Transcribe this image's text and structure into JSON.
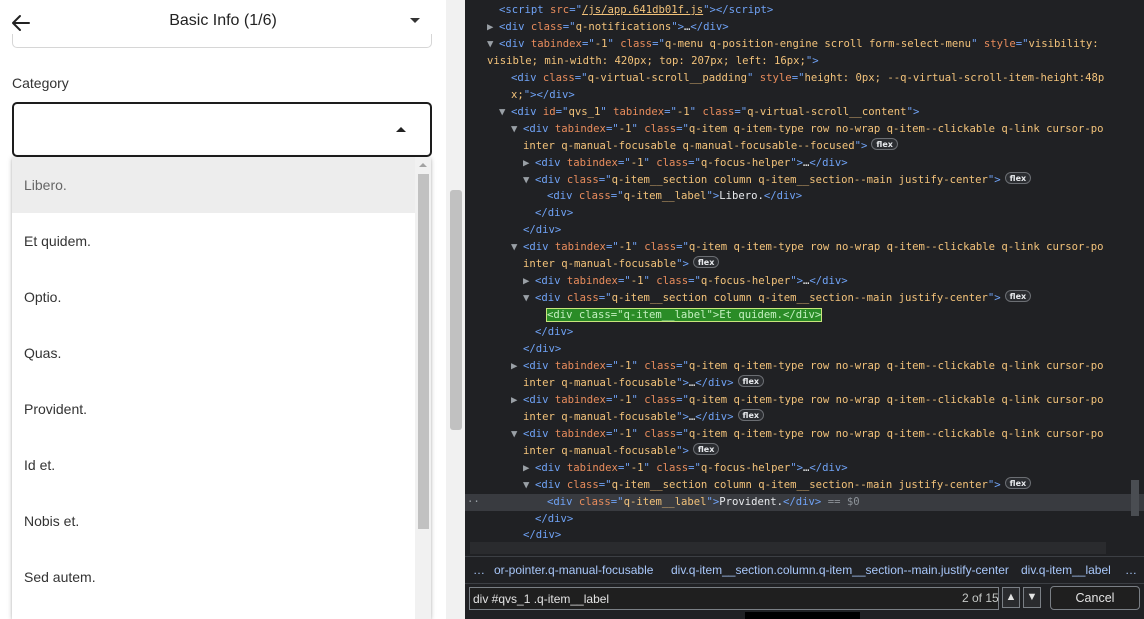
{
  "app": {
    "title": "Basic Info (1/6)",
    "back_icon": "arrow-left-icon",
    "category_label": "Category",
    "category_value": "",
    "options": [
      "Libero.",
      "Et quidem.",
      "Optio.",
      "Quas.",
      "Provident.",
      "Id et.",
      "Nobis et.",
      "Sed autem."
    ],
    "focused_option": "Libero."
  },
  "devtools": {
    "lines": [
      {
        "indent": 0,
        "tri": "",
        "html": "<span class='tg'>&lt;script</span> <span class='an'>src</span><span class='tg'>=\"</span><span class='av ul'>/js/app.641db01f.js</span><span class='tg'>\"&gt;&lt;/script&gt;</span>"
      },
      {
        "indent": 0,
        "tri": "▶",
        "html": "<span class='tg'>&lt;div</span> <span class='an'>class</span><span class='tg'>=\"</span><span class='av'>q-notifications</span><span class='tg'>\"&gt;</span><span class='tx'>…</span><span class='tg'>&lt;/div&gt;</span>"
      },
      {
        "indent": 0,
        "tri": "▼",
        "html": "<span class='tg'>&lt;div</span> <span class='an'>tabindex</span><span class='tg'>=\"</span><span class='av'>-1</span><span class='tg'>\"</span> <span class='an'>class</span><span class='tg'>=\"</span><span class='av'>q-menu q-position-engine scroll form-select-menu</span><span class='tg'>\"</span> <span class='an'>style</span><span class='tg'>=\"</span><span class='av'>visibility:</span>"
      },
      {
        "indent": -2,
        "tri": "",
        "html": "<span class='av'>visible; min-width: 420px; top: 207px; left: 16px;</span><span class='tg'>\"&gt;</span>"
      },
      {
        "indent": 1,
        "tri": "",
        "html": "<span class='tg'>&lt;div</span> <span class='an'>class</span><span class='tg'>=\"</span><span class='av'>q-virtual-scroll__padding</span><span class='tg'>\"</span> <span class='an'>style</span><span class='tg'>=\"</span><span class='av'>height: 0px; --q-virtual-scroll-item-height:48p</span>"
      },
      {
        "indent": 1,
        "tri": "",
        "html": "<span class='av'>x;</span><span class='tg'>\"&gt;&lt;/div&gt;</span>"
      },
      {
        "indent": 1,
        "tri": "▼",
        "html": "<span class='tg'>&lt;div</span> <span class='an'>id</span><span class='tg'>=\"</span><span class='av'>qvs_1</span><span class='tg'>\"</span> <span class='an'>tabindex</span><span class='tg'>=\"</span><span class='av'>-1</span><span class='tg'>\"</span> <span class='an'>class</span><span class='tg'>=\"</span><span class='av'>q-virtual-scroll__content</span><span class='tg'>\"&gt;</span>"
      },
      {
        "indent": 2,
        "tri": "▼",
        "html": "<span class='tg'>&lt;div</span> <span class='an'>tabindex</span><span class='tg'>=\"</span><span class='av'>-1</span><span class='tg'>\"</span> <span class='an'>class</span><span class='tg'>=\"</span><span class='av'>q-item q-item-type row no-wrap q-item--clickable q-link cursor-po</span>"
      },
      {
        "indent": 2,
        "tri": "",
        "html": "<span class='av'>inter q-manual-focusable q-manual-focusable--focused</span><span class='tg'>\"&gt;</span><span class='flex-badge'>flex</span>"
      },
      {
        "indent": 3,
        "tri": "▶",
        "html": "<span class='tg'>&lt;div</span> <span class='an'>tabindex</span><span class='tg'>=\"</span><span class='av'>-1</span><span class='tg'>\"</span> <span class='an'>class</span><span class='tg'>=\"</span><span class='av'>q-focus-helper</span><span class='tg'>\"&gt;</span><span class='tx'>…</span><span class='tg'>&lt;/div&gt;</span>"
      },
      {
        "indent": 3,
        "tri": "▼",
        "html": "<span class='tg'>&lt;div</span> <span class='an'>class</span><span class='tg'>=\"</span><span class='av'>q-item__section column q-item__section--main justify-center</span><span class='tg'>\"&gt;</span><span class='flex-badge'>flex</span>"
      },
      {
        "indent": 4,
        "tri": "",
        "html": "<span class='tg'>&lt;div</span> <span class='an'>class</span><span class='tg'>=\"</span><span class='av'>q-item__label</span><span class='tg'>\"&gt;</span><span class='tx'>Libero.</span><span class='tg'>&lt;/div&gt;</span>"
      },
      {
        "indent": 3,
        "tri": "",
        "html": "<span class='tg'>&lt;/div&gt;</span>"
      },
      {
        "indent": 2,
        "tri": "",
        "html": "<span class='tg'>&lt;/div&gt;</span>"
      },
      {
        "indent": 2,
        "tri": "▼",
        "html": "<span class='tg'>&lt;div</span> <span class='an'>tabindex</span><span class='tg'>=\"</span><span class='av'>-1</span><span class='tg'>\"</span> <span class='an'>class</span><span class='tg'>=\"</span><span class='av'>q-item q-item-type row no-wrap q-item--clickable q-link cursor-po</span>"
      },
      {
        "indent": 2,
        "tri": "",
        "html": "<span class='av'>inter q-manual-focusable</span><span class='tg'>\"&gt;</span><span class='flex-badge'>flex</span>"
      },
      {
        "indent": 3,
        "tri": "▶",
        "html": "<span class='tg'>&lt;div</span> <span class='an'>tabindex</span><span class='tg'>=\"</span><span class='av'>-1</span><span class='tg'>\"</span> <span class='an'>class</span><span class='tg'>=\"</span><span class='av'>q-focus-helper</span><span class='tg'>\"&gt;</span><span class='tx'>…</span><span class='tg'>&lt;/div&gt;</span>"
      },
      {
        "indent": 3,
        "tri": "▼",
        "html": "<span class='tg'>&lt;div</span> <span class='an'>class</span><span class='tg'>=\"</span><span class='av'>q-item__section column q-item__section--main justify-center</span><span class='tg'>\"&gt;</span><span class='flex-badge'>flex</span>"
      },
      {
        "indent": 4,
        "tri": "",
        "html": "<span class='hl'>&lt;div class=\"q-item__label\"&gt;Et quidem.&lt;/div&gt;</span>"
      },
      {
        "indent": 3,
        "tri": "",
        "html": "<span class='tg'>&lt;/div&gt;</span>"
      },
      {
        "indent": 2,
        "tri": "",
        "html": "<span class='tg'>&lt;/div&gt;</span>"
      },
      {
        "indent": 2,
        "tri": "▶",
        "html": "<span class='tg'>&lt;div</span> <span class='an'>tabindex</span><span class='tg'>=\"</span><span class='av'>-1</span><span class='tg'>\"</span> <span class='an'>class</span><span class='tg'>=\"</span><span class='av'>q-item q-item-type row no-wrap q-item--clickable q-link cursor-po</span>"
      },
      {
        "indent": 2,
        "tri": "",
        "html": "<span class='av'>inter q-manual-focusable</span><span class='tg'>\"&gt;</span><span class='tx'>…</span><span class='tg'>&lt;/div&gt;</span><span class='flex-badge'>flex</span>"
      },
      {
        "indent": 2,
        "tri": "▶",
        "html": "<span class='tg'>&lt;div</span> <span class='an'>tabindex</span><span class='tg'>=\"</span><span class='av'>-1</span><span class='tg'>\"</span> <span class='an'>class</span><span class='tg'>=\"</span><span class='av'>q-item q-item-type row no-wrap q-item--clickable q-link cursor-po</span>"
      },
      {
        "indent": 2,
        "tri": "",
        "html": "<span class='av'>inter q-manual-focusable</span><span class='tg'>\"&gt;</span><span class='tx'>…</span><span class='tg'>&lt;/div&gt;</span><span class='flex-badge'>flex</span>"
      },
      {
        "indent": 2,
        "tri": "▼",
        "html": "<span class='tg'>&lt;div</span> <span class='an'>tabindex</span><span class='tg'>=\"</span><span class='av'>-1</span><span class='tg'>\"</span> <span class='an'>class</span><span class='tg'>=\"</span><span class='av'>q-item q-item-type row no-wrap q-item--clickable q-link cursor-po</span>"
      },
      {
        "indent": 2,
        "tri": "",
        "html": "<span class='av'>inter q-manual-focusable</span><span class='tg'>\"&gt;</span><span class='flex-badge'>flex</span>"
      },
      {
        "indent": 3,
        "tri": "▶",
        "html": "<span class='tg'>&lt;div</span> <span class='an'>tabindex</span><span class='tg'>=\"</span><span class='av'>-1</span><span class='tg'>\"</span> <span class='an'>class</span><span class='tg'>=\"</span><span class='av'>q-focus-helper</span><span class='tg'>\"&gt;</span><span class='tx'>…</span><span class='tg'>&lt;/div&gt;</span>"
      },
      {
        "indent": 3,
        "tri": "▼",
        "html": "<span class='tg'>&lt;div</span> <span class='an'>class</span><span class='tg'>=\"</span><span class='av'>q-item__section column q-item__section--main justify-center</span><span class='tg'>\"&gt;</span><span class='flex-badge'>flex</span>"
      },
      {
        "indent": 4,
        "tri": "",
        "selected": true,
        "html": "<span class='tg'>&lt;div</span> <span class='an'>class</span><span class='tg'>=\"</span><span class='av'>q-item__label</span><span class='tg'>\"&gt;</span><span class='tx'>Provident.</span><span class='tg'>&lt;/div&gt;</span> <span class='dim'>== $0</span>"
      },
      {
        "indent": 3,
        "tri": "",
        "html": "<span class='tg'>&lt;/div&gt;</span>"
      },
      {
        "indent": 2,
        "tri": "",
        "html": "<span class='tg'>&lt;/div&gt;</span>"
      }
    ],
    "breadcrumbs": [
      "…",
      "or-pointer.q-manual-focusable",
      "div.q-item__section.column.q-item__section--main.justify-center",
      "div.q-item__label",
      "…"
    ],
    "search_query": "div #qvs_1 .q-item__label",
    "match_count": "2 of 15",
    "cancel_label": "Cancel",
    "selected_marker": "··"
  }
}
